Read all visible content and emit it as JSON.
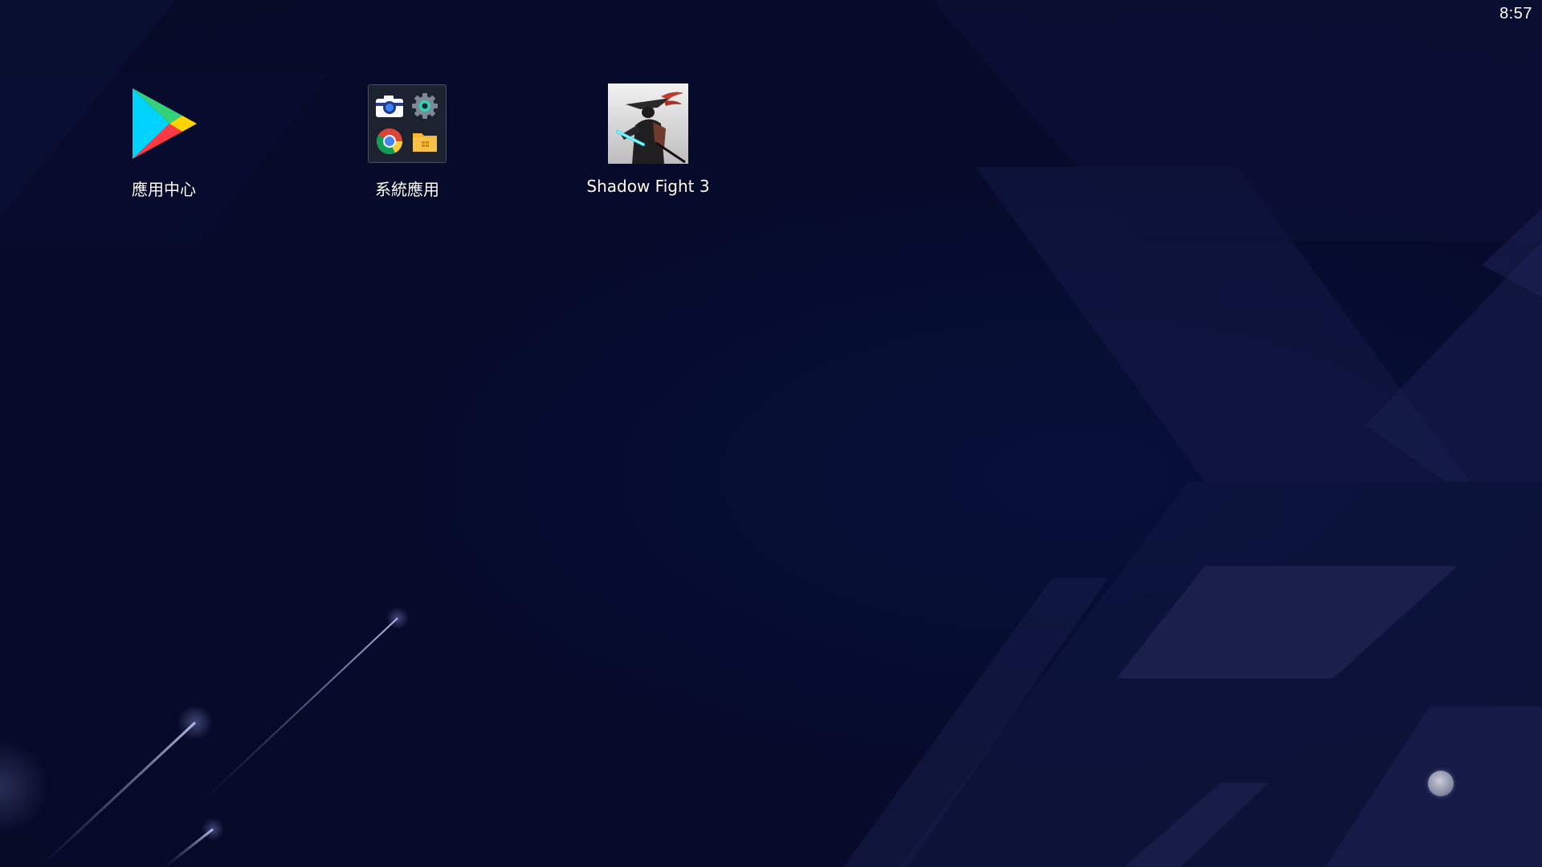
{
  "status_bar": {
    "time": "8:57"
  },
  "desktop": {
    "apps": [
      {
        "label": "應用中心",
        "icon": "play-store-icon"
      },
      {
        "label": "系統應用",
        "icon": "system-apps-folder-icon",
        "folder_items": [
          "camera-icon",
          "settings-icon",
          "chrome-icon",
          "file-manager-icon"
        ]
      },
      {
        "label": "Shadow Fight 3",
        "icon": "shadow-fight-3-icon"
      }
    ]
  },
  "colors": {
    "background": "#060b2a",
    "label_text": "#ffffff"
  }
}
